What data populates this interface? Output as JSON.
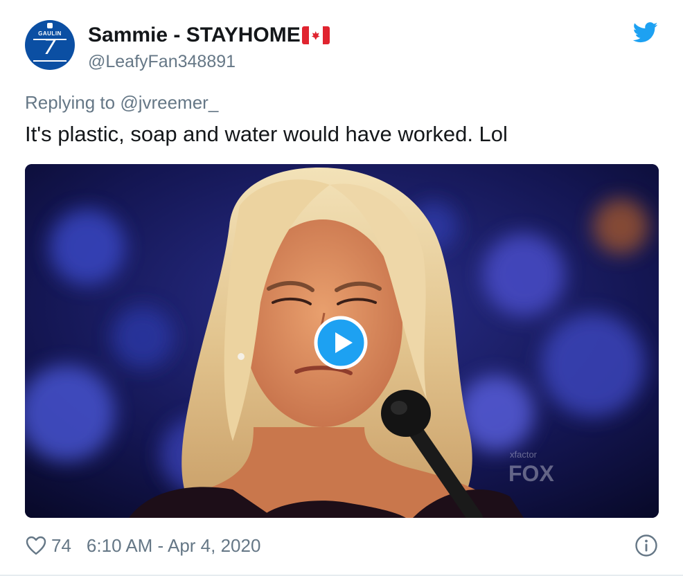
{
  "author": {
    "display_name": "Sammie - STAYHOME",
    "handle": "@LeafyFan348891",
    "flag_icon": "canada-flag-icon",
    "avatar": {
      "jersey_text": "GAULIN",
      "jersey_number": "7",
      "background_color": "#0b4fa3"
    }
  },
  "reply": {
    "prefix": "Replying to",
    "mention": "@jvreemer_"
  },
  "tweet": {
    "text": "It's plastic, soap and water would have worked. Lol"
  },
  "media": {
    "type": "gif-video",
    "play_icon": "play-icon",
    "watermark_small": "xfactor",
    "watermark_fox": "FOX"
  },
  "footer": {
    "like_icon": "heart-icon",
    "like_count": "74",
    "timestamp": "6:10 AM - Apr 4, 2020",
    "info_icon": "info-icon"
  },
  "colors": {
    "brand_blue": "#1da1f2",
    "text_primary": "#14171a",
    "text_secondary": "#657786"
  }
}
